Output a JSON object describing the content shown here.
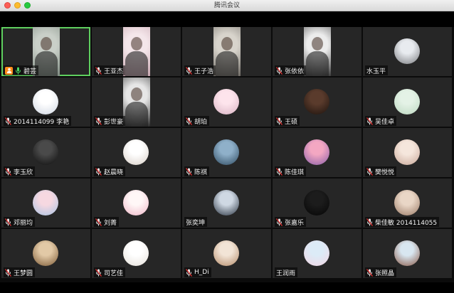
{
  "window": {
    "title": "腾讯会议"
  },
  "participants": [
    {
      "name": "碧芸",
      "type": "video",
      "mic": "on",
      "host": true,
      "active": true,
      "bg": [
        "#c9cfc8",
        "#7d8a80"
      ]
    },
    {
      "name": "王亚杰",
      "type": "video",
      "mic": "off",
      "bg": [
        "#f4e6ea",
        "#c7a6b0"
      ]
    },
    {
      "name": "王子浩",
      "type": "video",
      "mic": "off",
      "bg": [
        "#d8d4cc",
        "#6e6a64"
      ]
    },
    {
      "name": "张依依",
      "type": "video",
      "mic": "off",
      "bg": [
        "#ececec",
        "#3a3a3a"
      ]
    },
    {
      "name": "水玉平",
      "type": "avatar",
      "mic": "none",
      "bg": [
        "#e8ebef",
        "#7a7c80"
      ]
    },
    {
      "name": "2014114099 李艳",
      "type": "avatar",
      "mic": "off",
      "bg": [
        "#ffffff",
        "#cfd6e2"
      ]
    },
    {
      "name": "彭世豪",
      "type": "video",
      "mic": "off",
      "bg": [
        "#e6e6e6",
        "#2a2a2a"
      ]
    },
    {
      "name": "胡珀",
      "type": "avatar",
      "mic": "off",
      "bg": [
        "#fde4ec",
        "#d9b3c3"
      ]
    },
    {
      "name": "王硕",
      "type": "avatar",
      "mic": "off",
      "bg": [
        "#5a3b2c",
        "#1c120d"
      ]
    },
    {
      "name": "吴佳卓",
      "type": "avatar",
      "mic": "off",
      "bg": [
        "#e4f2e6",
        "#bcd8c0"
      ]
    },
    {
      "name": "李玉欣",
      "type": "avatar",
      "mic": "off",
      "bg": [
        "#4a4a4a",
        "#0d0d0d"
      ]
    },
    {
      "name": "赵晨晓",
      "type": "avatar",
      "mic": "off",
      "bg": [
        "#ffffff",
        "#d9d0c8"
      ]
    },
    {
      "name": "陈祺",
      "type": "avatar",
      "mic": "off",
      "bg": [
        "#8fb0c9",
        "#2e4a60"
      ]
    },
    {
      "name": "陈佳琪",
      "type": "avatar",
      "mic": "off",
      "bg": [
        "#f3a7c2",
        "#8a5ea8"
      ]
    },
    {
      "name": "樊悦悦",
      "type": "avatar",
      "mic": "off",
      "bg": [
        "#f5e6dc",
        "#c9a899"
      ]
    },
    {
      "name": "邓丽均",
      "type": "avatar",
      "mic": "off",
      "bg": [
        "#f6d8e1",
        "#a9c4e3"
      ]
    },
    {
      "name": "刘菁",
      "type": "avatar",
      "mic": "off",
      "bg": [
        "#fff7f7",
        "#f0b8c8"
      ]
    },
    {
      "name": "张奕坤",
      "type": "avatar",
      "mic": "none",
      "bg": [
        "#cfd8e3",
        "#2b3542"
      ]
    },
    {
      "name": "张嘉乐",
      "type": "avatar",
      "mic": "off",
      "bg": [
        "#1c1c1c",
        "#050505"
      ]
    },
    {
      "name": "柴佳敏 2014114055",
      "type": "avatar",
      "mic": "off",
      "bg": [
        "#e9d6c6",
        "#9a7a66"
      ]
    },
    {
      "name": "王梦圆",
      "type": "avatar",
      "mic": "off",
      "bg": [
        "#e2c9a6",
        "#7c5a36"
      ]
    },
    {
      "name": "司艺佳",
      "type": "avatar",
      "mic": "off",
      "bg": [
        "#ffffff",
        "#e6e1da"
      ]
    },
    {
      "name": "H_Di",
      "type": "avatar",
      "mic": "off",
      "bg": [
        "#f2e4d6",
        "#b58c6a"
      ]
    },
    {
      "name": "王润雨",
      "type": "avatar",
      "mic": "none",
      "bg": [
        "#dcebf7",
        "#f2d6e4"
      ]
    },
    {
      "name": "张照晶",
      "type": "avatar",
      "mic": "off",
      "bg": [
        "#d8e6f0",
        "#8a5a48"
      ]
    }
  ]
}
